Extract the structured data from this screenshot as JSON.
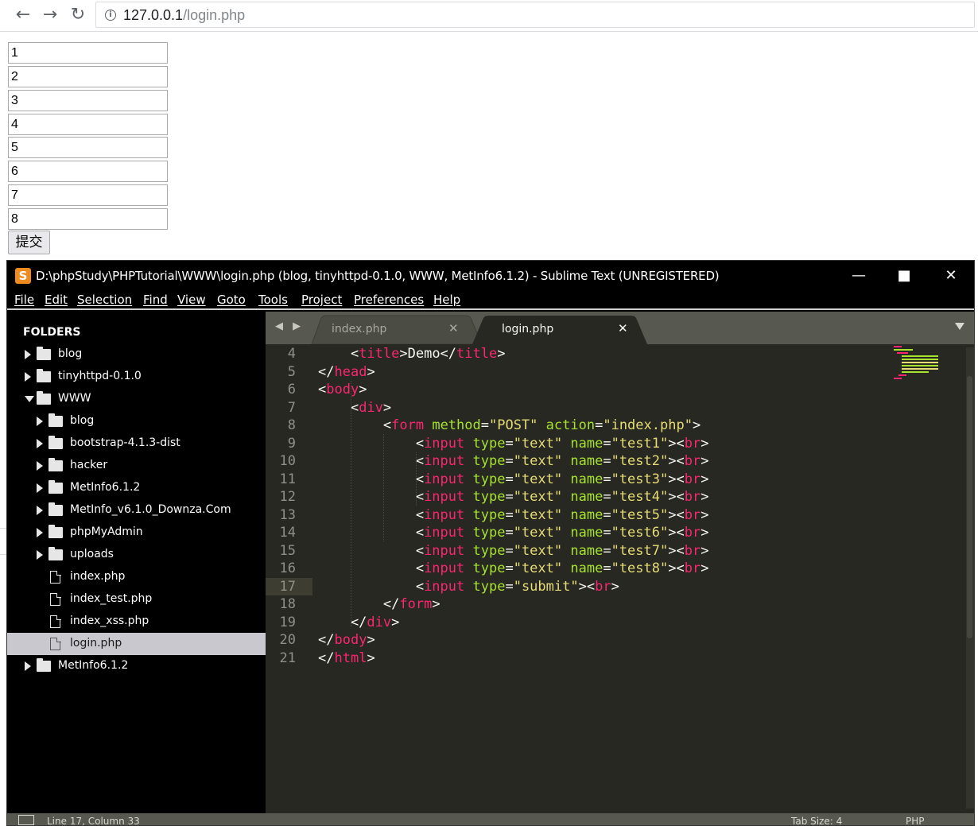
{
  "browser": {
    "back_icon": "←",
    "forward_icon": "→",
    "reload_icon": "↻",
    "info_icon": "i",
    "url_host": "127.0.0.1",
    "url_path": "/login.php"
  },
  "form": {
    "inputs": [
      "1",
      "2",
      "3",
      "4",
      "5",
      "6",
      "7",
      "8"
    ],
    "submit_label": "提交"
  },
  "sublime": {
    "logo": "S",
    "title": "D:\\phpStudy\\PHPTutorial\\WWW\\login.php (blog, tinyhttpd-0.1.0, WWW, MetInfo6.1.2) - Sublime Text (UNREGISTERED)",
    "window_buttons": {
      "minimize": "—",
      "maximize": "■",
      "close": "✕"
    },
    "menu": [
      "File",
      "Edit",
      "Selection",
      "Find",
      "View",
      "Goto",
      "Tools",
      "Project",
      "Preferences",
      "Help"
    ],
    "sidebar": {
      "header": "FOLDERS",
      "items": [
        {
          "label": "blog",
          "type": "folder",
          "expanded": false,
          "depth": 0
        },
        {
          "label": "tinyhttpd-0.1.0",
          "type": "folder",
          "expanded": false,
          "depth": 0
        },
        {
          "label": "WWW",
          "type": "folder",
          "expanded": true,
          "depth": 0
        },
        {
          "label": "blog",
          "type": "folder",
          "expanded": false,
          "depth": 1
        },
        {
          "label": "bootstrap-4.1.3-dist",
          "type": "folder",
          "expanded": false,
          "depth": 1
        },
        {
          "label": "hacker",
          "type": "folder",
          "expanded": false,
          "depth": 1
        },
        {
          "label": "MetInfo6.1.2",
          "type": "folder",
          "expanded": false,
          "depth": 1
        },
        {
          "label": "MetInfo_v6.1.0_Downza.Com",
          "type": "folder",
          "expanded": false,
          "depth": 1
        },
        {
          "label": "phpMyAdmin",
          "type": "folder",
          "expanded": false,
          "depth": 1
        },
        {
          "label": "uploads",
          "type": "folder",
          "expanded": false,
          "depth": 1
        },
        {
          "label": "index.php",
          "type": "file",
          "depth": 1
        },
        {
          "label": "index_test.php",
          "type": "file",
          "depth": 1
        },
        {
          "label": "index_xss.php",
          "type": "file",
          "depth": 1
        },
        {
          "label": "login.php",
          "type": "file",
          "depth": 1,
          "selected": true
        },
        {
          "label": "MetInfo6.1.2",
          "type": "folder",
          "expanded": false,
          "depth": 0
        }
      ]
    },
    "tabs": {
      "nav": "◀ ▶",
      "items": [
        {
          "label": "index.php",
          "active": false
        },
        {
          "label": "login.php",
          "active": true
        }
      ],
      "close_glyph": "✕"
    },
    "editor": {
      "current_line": 17,
      "lines": [
        {
          "num": "4",
          "tokens": [
            [
              "t",
              "    <"
            ],
            [
              "tag",
              "title"
            ],
            [
              "t",
              ">Demo</"
            ],
            [
              "tag",
              "title"
            ],
            [
              "t",
              ">"
            ]
          ]
        },
        {
          "num": "5",
          "tokens": [
            [
              "t",
              "</"
            ],
            [
              "tag",
              "head"
            ],
            [
              "t",
              ">"
            ]
          ]
        },
        {
          "num": "6",
          "tokens": [
            [
              "t",
              "<"
            ],
            [
              "tag",
              "body"
            ],
            [
              "t",
              ">"
            ]
          ]
        },
        {
          "num": "7",
          "tokens": [
            [
              "t",
              "    <"
            ],
            [
              "tag",
              "div"
            ],
            [
              "t",
              ">"
            ]
          ]
        },
        {
          "num": "8",
          "tokens": [
            [
              "t",
              "        <"
            ],
            [
              "tag",
              "form"
            ],
            [
              "t",
              " "
            ],
            [
              "attr",
              "method"
            ],
            [
              "t",
              "="
            ],
            [
              "str",
              "\"POST\""
            ],
            [
              "t",
              " "
            ],
            [
              "attr",
              "action"
            ],
            [
              "t",
              "="
            ],
            [
              "str",
              "\"index.php\""
            ],
            [
              "t",
              ">"
            ]
          ]
        },
        {
          "num": "9",
          "tokens": [
            [
              "t",
              "            <"
            ],
            [
              "tag",
              "input"
            ],
            [
              "t",
              " "
            ],
            [
              "attr",
              "type"
            ],
            [
              "t",
              "="
            ],
            [
              "str",
              "\"text\""
            ],
            [
              "t",
              " "
            ],
            [
              "attr",
              "name"
            ],
            [
              "t",
              "="
            ],
            [
              "str",
              "\"test1\""
            ],
            [
              "t",
              "><"
            ],
            [
              "tag",
              "br"
            ],
            [
              "t",
              ">"
            ]
          ]
        },
        {
          "num": "10",
          "tokens": [
            [
              "t",
              "            <"
            ],
            [
              "tag",
              "input"
            ],
            [
              "t",
              " "
            ],
            [
              "attr",
              "type"
            ],
            [
              "t",
              "="
            ],
            [
              "str",
              "\"text\""
            ],
            [
              "t",
              " "
            ],
            [
              "attr",
              "name"
            ],
            [
              "t",
              "="
            ],
            [
              "str",
              "\"test2\""
            ],
            [
              "t",
              "><"
            ],
            [
              "tag",
              "br"
            ],
            [
              "t",
              ">"
            ]
          ]
        },
        {
          "num": "11",
          "tokens": [
            [
              "t",
              "            <"
            ],
            [
              "tag",
              "input"
            ],
            [
              "t",
              " "
            ],
            [
              "attr",
              "type"
            ],
            [
              "t",
              "="
            ],
            [
              "str",
              "\"text\""
            ],
            [
              "t",
              " "
            ],
            [
              "attr",
              "name"
            ],
            [
              "t",
              "="
            ],
            [
              "str",
              "\"test3\""
            ],
            [
              "t",
              "><"
            ],
            [
              "tag",
              "br"
            ],
            [
              "t",
              ">"
            ]
          ]
        },
        {
          "num": "12",
          "tokens": [
            [
              "t",
              "            <"
            ],
            [
              "tag",
              "input"
            ],
            [
              "t",
              " "
            ],
            [
              "attr",
              "type"
            ],
            [
              "t",
              "="
            ],
            [
              "str",
              "\"text\""
            ],
            [
              "t",
              " "
            ],
            [
              "attr",
              "name"
            ],
            [
              "t",
              "="
            ],
            [
              "str",
              "\"test4\""
            ],
            [
              "t",
              "><"
            ],
            [
              "tag",
              "br"
            ],
            [
              "t",
              ">"
            ]
          ]
        },
        {
          "num": "13",
          "tokens": [
            [
              "t",
              "            <"
            ],
            [
              "tag",
              "input"
            ],
            [
              "t",
              " "
            ],
            [
              "attr",
              "type"
            ],
            [
              "t",
              "="
            ],
            [
              "str",
              "\"text\""
            ],
            [
              "t",
              " "
            ],
            [
              "attr",
              "name"
            ],
            [
              "t",
              "="
            ],
            [
              "str",
              "\"test5\""
            ],
            [
              "t",
              "><"
            ],
            [
              "tag",
              "br"
            ],
            [
              "t",
              ">"
            ]
          ]
        },
        {
          "num": "14",
          "tokens": [
            [
              "t",
              "            <"
            ],
            [
              "tag",
              "input"
            ],
            [
              "t",
              " "
            ],
            [
              "attr",
              "type"
            ],
            [
              "t",
              "="
            ],
            [
              "str",
              "\"text\""
            ],
            [
              "t",
              " "
            ],
            [
              "attr",
              "name"
            ],
            [
              "t",
              "="
            ],
            [
              "str",
              "\"test6\""
            ],
            [
              "t",
              "><"
            ],
            [
              "tag",
              "br"
            ],
            [
              "t",
              ">"
            ]
          ]
        },
        {
          "num": "15",
          "tokens": [
            [
              "t",
              "            <"
            ],
            [
              "tag",
              "input"
            ],
            [
              "t",
              " "
            ],
            [
              "attr",
              "type"
            ],
            [
              "t",
              "="
            ],
            [
              "str",
              "\"text\""
            ],
            [
              "t",
              " "
            ],
            [
              "attr",
              "name"
            ],
            [
              "t",
              "="
            ],
            [
              "str",
              "\"test7\""
            ],
            [
              "t",
              "><"
            ],
            [
              "tag",
              "br"
            ],
            [
              "t",
              ">"
            ]
          ]
        },
        {
          "num": "16",
          "tokens": [
            [
              "t",
              "            <"
            ],
            [
              "tag",
              "input"
            ],
            [
              "t",
              " "
            ],
            [
              "attr",
              "type"
            ],
            [
              "t",
              "="
            ],
            [
              "str",
              "\"text\""
            ],
            [
              "t",
              " "
            ],
            [
              "attr",
              "name"
            ],
            [
              "t",
              "="
            ],
            [
              "str",
              "\"test8\""
            ],
            [
              "t",
              "><"
            ],
            [
              "tag",
              "br"
            ],
            [
              "t",
              ">"
            ]
          ]
        },
        {
          "num": "17",
          "tokens": [
            [
              "t",
              "            <"
            ],
            [
              "tag",
              "input"
            ],
            [
              "t",
              " "
            ],
            [
              "attr",
              "type"
            ],
            [
              "t",
              "="
            ],
            [
              "str",
              "\"submit\""
            ],
            [
              "t",
              "><"
            ],
            [
              "tag",
              "br"
            ],
            [
              "t",
              ">"
            ]
          ]
        },
        {
          "num": "18",
          "tokens": [
            [
              "t",
              "        </"
            ],
            [
              "tag",
              "form"
            ],
            [
              "t",
              ">"
            ]
          ]
        },
        {
          "num": "19",
          "tokens": [
            [
              "t",
              "    </"
            ],
            [
              "tag",
              "div"
            ],
            [
              "t",
              ">"
            ]
          ]
        },
        {
          "num": "20",
          "tokens": [
            [
              "t",
              "</"
            ],
            [
              "tag",
              "body"
            ],
            [
              "t",
              ">"
            ]
          ]
        },
        {
          "num": "21",
          "tokens": [
            [
              "t",
              "</"
            ],
            [
              "tag",
              "html"
            ],
            [
              "t",
              ">"
            ]
          ]
        }
      ]
    },
    "status": {
      "position": "Line 17, Column 33",
      "tab_size": "Tab Size: 4",
      "syntax": "PHP"
    },
    "colors": {
      "tag": "#f92672",
      "attr": "#a6e22e",
      "string": "#e6db74",
      "text": "#f8f8f2",
      "editor_bg": "#272822",
      "logo": "#ef8a1e"
    }
  }
}
